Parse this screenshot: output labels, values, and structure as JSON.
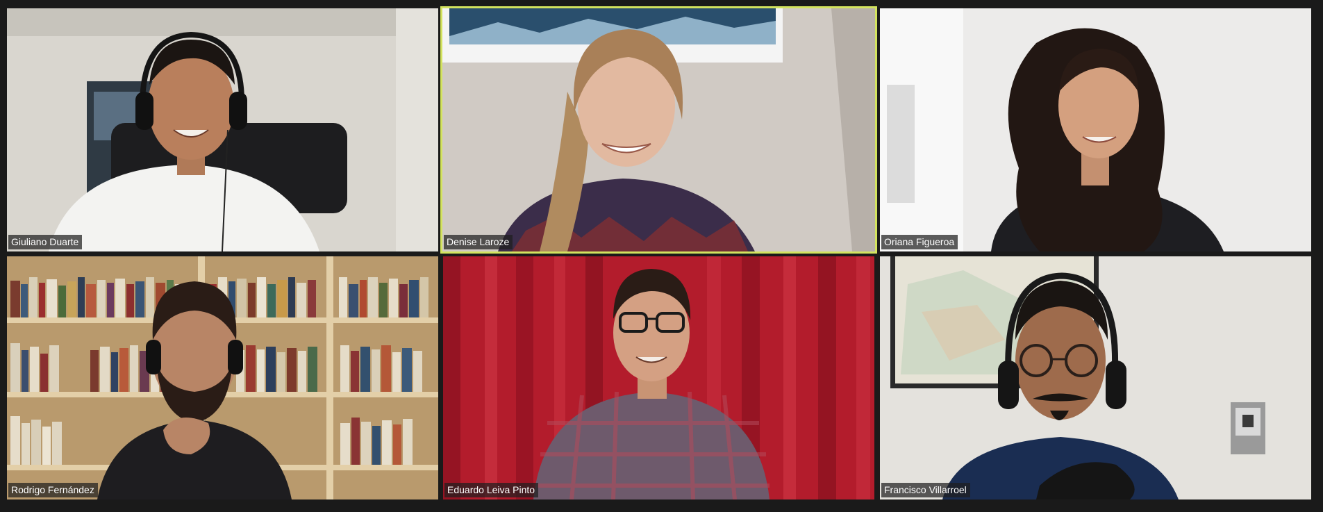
{
  "app": {
    "view": "gallery-view",
    "background_color": "#1a1a1a",
    "active_speaker_border_color": "#d3e35e"
  },
  "participants": [
    {
      "name": "Giuliano Duarte",
      "speaking": false
    },
    {
      "name": "Denise Laroze",
      "speaking": true
    },
    {
      "name": "Oriana Figueroa",
      "speaking": false
    },
    {
      "name": "Rodrigo Fernández",
      "speaking": false
    },
    {
      "name": "Eduardo Leiva Pinto",
      "speaking": false
    },
    {
      "name": "Francisco Villarroel",
      "speaking": false
    }
  ]
}
